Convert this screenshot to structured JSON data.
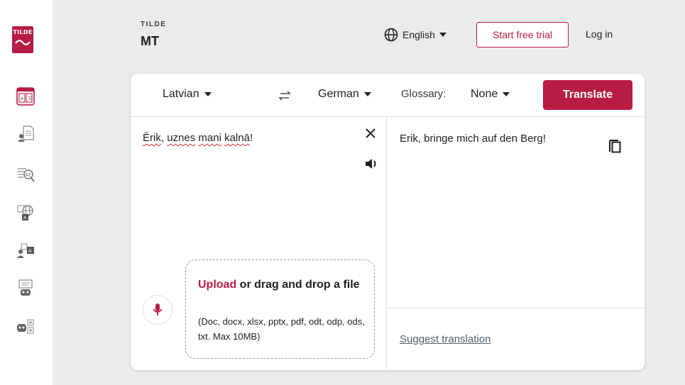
{
  "brand": {
    "logo_text": "TILDE",
    "small": "TILDE",
    "big": "MT",
    "accent": "#b71c45"
  },
  "header": {
    "ui_language": "English",
    "trial_label": "Start free trial",
    "login_label": "Log in"
  },
  "sidebar": {
    "items": [
      {
        "icon": "text-translate-icon",
        "active": true
      },
      {
        "icon": "document-translate-icon",
        "active": false
      },
      {
        "icon": "terminology-search-icon",
        "active": false
      },
      {
        "icon": "website-translate-icon",
        "active": false
      },
      {
        "icon": "speech-translate-icon",
        "active": false
      },
      {
        "icon": "chatbot-icon",
        "active": false
      },
      {
        "icon": "ai-assistant-icon",
        "active": false
      }
    ]
  },
  "toolbar": {
    "source_lang": "Latvian",
    "target_lang": "German",
    "glossary_label": "Glossary:",
    "glossary_value": "None",
    "translate_label": "Translate"
  },
  "source": {
    "words": [
      "Ērik",
      ", ",
      "uznes",
      " ",
      "mani",
      " ",
      "kalnā",
      "!"
    ]
  },
  "upload": {
    "link": "Upload",
    "rest": " or drag and drop a file",
    "hint": "(Doc, docx, xlsx, pptx, pdf, odt, odp, ods, txt. Max 10MB)"
  },
  "target": {
    "text": "Erik, bringe mich auf den Berg!",
    "suggest_label": "Suggest translation"
  }
}
